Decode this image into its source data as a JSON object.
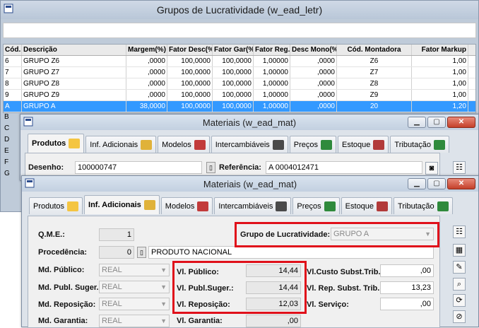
{
  "main_window": {
    "title": "Grupos de Lucratividade (w_ead_letr)",
    "columns": [
      "Cód.",
      "Descrição",
      "Margem(%)",
      "Fator Desc(%",
      "Fator Gar(%",
      "Fator Reg.",
      "Desc Mono(%",
      "Cód. Montadora",
      "Fator Markup"
    ],
    "rows": [
      [
        "6",
        "GRUPO Z6",
        ",0000",
        "100,0000",
        "100,0000",
        "1,00000",
        ",0000",
        "Z6",
        "1,00"
      ],
      [
        "7",
        "GRUPO Z7",
        ",0000",
        "100,0000",
        "100,0000",
        "1,00000",
        ",0000",
        "Z7",
        "1,00"
      ],
      [
        "8",
        "GRUPO Z8",
        ",0000",
        "100,0000",
        "100,0000",
        "1,00000",
        ",0000",
        "Z8",
        "1,00"
      ],
      [
        "9",
        "GRUPO Z9",
        ",0000",
        "100,0000",
        "100,0000",
        "1,00000",
        ",0000",
        "Z9",
        "1,00"
      ],
      [
        "A",
        "GRUPO A",
        "38,0000",
        "100,0000",
        "100,0000",
        "1,00000",
        ",0000",
        "20",
        "1,20"
      ]
    ],
    "left_codes": [
      "B",
      "C",
      "D",
      "E",
      "F",
      "G"
    ]
  },
  "materiais_back": {
    "title": "Materiais (w_ead_mat)",
    "tabs": [
      "Produtos",
      "Inf. Adicionais",
      "Modelos",
      "Intercambiáveis",
      "Preços",
      "Estoque",
      "Tributação"
    ],
    "desenho_label": "Desenho:",
    "desenho_value": "100000747",
    "referencia_label": "Referência:",
    "referencia_value": "A 0004012471"
  },
  "materiais_front": {
    "title": "Materiais (w_ead_mat)",
    "tabs": [
      "Produtos",
      "Inf. Adicionais",
      "Modelos",
      "Intercambiáveis",
      "Preços",
      "Estoque",
      "Tributação"
    ],
    "qme_label": "Q.M.E.:",
    "qme_value": "1",
    "grupo_label": "Grupo de Lucratividade:",
    "grupo_value": "GRUPO A",
    "procedencia_label": "Procedência:",
    "procedencia_code": "0",
    "procedencia_text": "PRODUTO NACIONAL",
    "md_publico_label": "Md. Público:",
    "md_publico_value": "REAL",
    "md_publ_suger_label": "Md. Publ. Suger.:",
    "md_publ_suger_value": "REAL",
    "md_reposicao_label": "Md. Reposição:",
    "md_reposicao_value": "REAL",
    "md_garantia_label": "Md. Garantia:",
    "md_garantia_value": "REAL",
    "vl_publico_label": "Vl. Público:",
    "vl_publico_value": "14,44",
    "vl_publ_suger_label": "Vl. Publ.Suger.:",
    "vl_publ_suger_value": "14,44",
    "vl_reposicao_label": "Vl. Reposição:",
    "vl_reposicao_value": "12,03",
    "vl_garantia_label": "Vl. Garantia:",
    "vl_garantia_value": ",00",
    "vl_custo_subst_label": "Vl.Custo Subst.Trib.:",
    "vl_custo_subst_value": ",00",
    "vl_rep_subst_label": "Vl. Rep. Subst. Trib.:",
    "vl_rep_subst_value": "13,23",
    "vl_servico_label": "Vl. Serviço:",
    "vl_servico_value": ",00"
  },
  "colors": {
    "highlight": "#e0101a",
    "selection": "#3399ff"
  }
}
